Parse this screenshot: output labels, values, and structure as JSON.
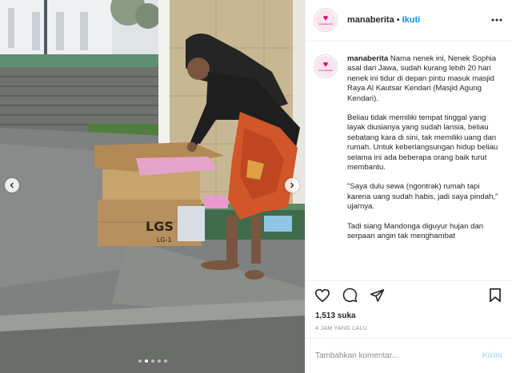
{
  "header": {
    "username": "manaberita",
    "separator": "•",
    "follow_label": "Ikuti",
    "avatar_icon": "heart-logo-icon",
    "avatar_text": "manaberita"
  },
  "caption": {
    "username": "manaberita",
    "paragraphs": [
      "Nama nenek ini, Nenek Sophia asal dari Jawa, sudah kurang lebih 20 hari nenek ini tidur di depan pintu masuk masjid Raya Al Kautsar Kendari (Masjid Agung Kendari).",
      "Beliau tidak memiliki tempat tinggal yang layak diusianya yang sudah lansia, beliau sebatang kara di sini, tak memiliki uang dan rumah. Untuk keberlangsungan hidup beliau selama ini ada beberapa orang baik turut membantu.",
      "\"Saya dulu sewa (ngontrak) rumah tapi karena uang sudah habis, jadi saya pindah,\" ujarnya.",
      "Tadi siang Mandonga diguyur hujan dan serpaan angin tak menghambat"
    ]
  },
  "media": {
    "box_print": "LGS",
    "box_print_sub": "LG-1"
  },
  "actions": {
    "like_icon": "heart-outline-icon",
    "comment_icon": "comment-icon",
    "share_icon": "share-icon",
    "save_icon": "bookmark-icon"
  },
  "likes_text": "1,513 suka",
  "timestamp": "4 JAM YANG LALU",
  "comment": {
    "placeholder": "Tambahkan komentar...",
    "post_label": "Kirim"
  },
  "colors": {
    "link_blue": "#0095f6",
    "post_disabled": "#b2dffc",
    "brand_pink": "#e6007e"
  }
}
